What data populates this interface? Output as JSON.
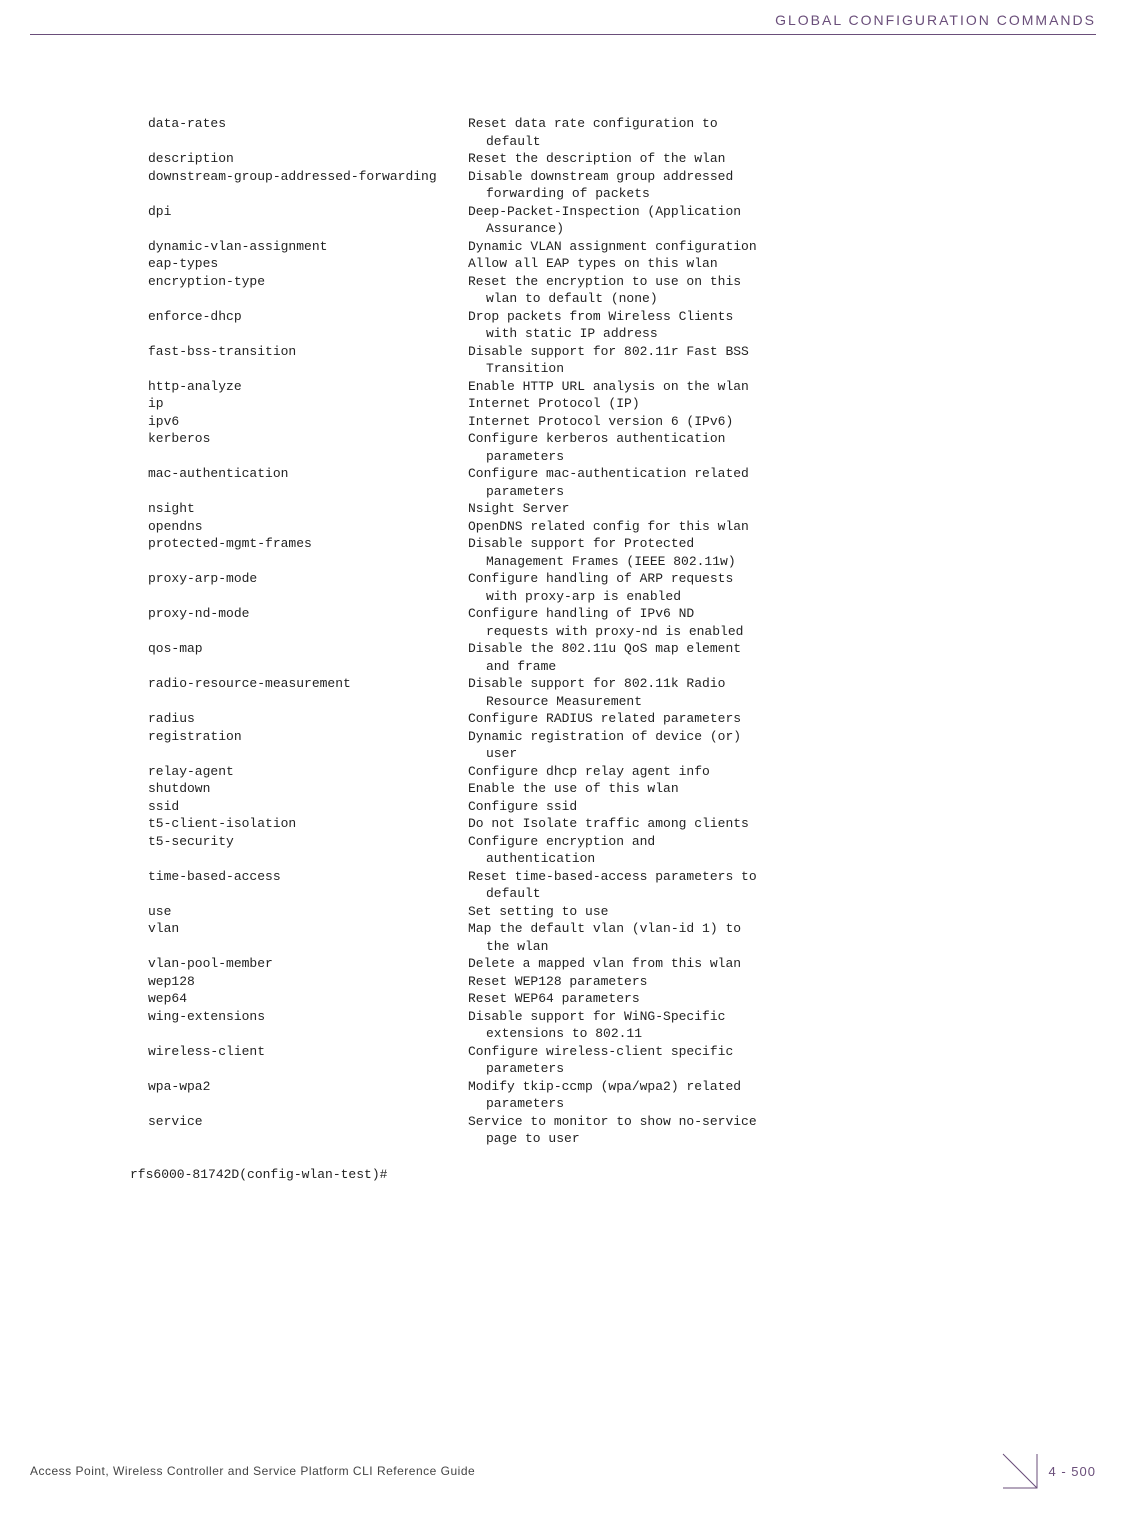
{
  "header": {
    "title": "GLOBAL CONFIGURATION COMMANDS"
  },
  "entries": [
    {
      "key": "data-rates",
      "lines": [
        "Reset data rate configuration to",
        "default"
      ]
    },
    {
      "key": "description",
      "lines": [
        "Reset the description of the wlan"
      ]
    },
    {
      "key": "downstream-group-addressed-forwarding",
      "lines": [
        "Disable downstream group addressed",
        "forwarding of packets"
      ]
    },
    {
      "key": "dpi",
      "lines": [
        "Deep-Packet-Inspection (Application",
        "Assurance)"
      ]
    },
    {
      "key": "dynamic-vlan-assignment",
      "lines": [
        "Dynamic VLAN assignment configuration"
      ]
    },
    {
      "key": "eap-types",
      "lines": [
        "Allow all EAP types on this wlan"
      ]
    },
    {
      "key": "encryption-type",
      "lines": [
        "Reset the encryption to use on this",
        "wlan to default (none)"
      ]
    },
    {
      "key": "enforce-dhcp",
      "lines": [
        "Drop packets from Wireless Clients",
        "with static IP address"
      ]
    },
    {
      "key": "fast-bss-transition",
      "lines": [
        "Disable support for 802.11r Fast BSS",
        "Transition"
      ]
    },
    {
      "key": "http-analyze",
      "lines": [
        "Enable HTTP URL analysis on the wlan"
      ]
    },
    {
      "key": "ip",
      "lines": [
        "Internet Protocol (IP)"
      ]
    },
    {
      "key": "ipv6",
      "lines": [
        "Internet Protocol version 6 (IPv6)"
      ]
    },
    {
      "key": "kerberos",
      "lines": [
        "Configure kerberos authentication",
        "parameters"
      ]
    },
    {
      "key": "mac-authentication",
      "lines": [
        "Configure mac-authentication related",
        "parameters"
      ]
    },
    {
      "key": "nsight",
      "lines": [
        "Nsight Server"
      ]
    },
    {
      "key": "opendns",
      "lines": [
        "OpenDNS related config for this wlan"
      ]
    },
    {
      "key": "protected-mgmt-frames",
      "lines": [
        "Disable support for Protected",
        "Management Frames (IEEE 802.11w)"
      ]
    },
    {
      "key": "proxy-arp-mode",
      "lines": [
        "Configure handling of ARP requests",
        "with proxy-arp is enabled"
      ]
    },
    {
      "key": "proxy-nd-mode",
      "lines": [
        "Configure handling of IPv6 ND",
        "requests with proxy-nd is enabled"
      ]
    },
    {
      "key": "qos-map",
      "lines": [
        "Disable the 802.11u QoS map element",
        "and frame"
      ]
    },
    {
      "key": "radio-resource-measurement",
      "lines": [
        "Disable support for 802.11k Radio",
        "Resource Measurement"
      ]
    },
    {
      "key": "radius",
      "lines": [
        "Configure RADIUS related parameters"
      ]
    },
    {
      "key": "registration",
      "lines": [
        "Dynamic registration of device (or)",
        "user"
      ]
    },
    {
      "key": "relay-agent",
      "lines": [
        "Configure dhcp relay agent info"
      ]
    },
    {
      "key": "shutdown",
      "lines": [
        "Enable the use of this wlan"
      ]
    },
    {
      "key": "ssid",
      "lines": [
        "Configure ssid"
      ]
    },
    {
      "key": "t5-client-isolation",
      "lines": [
        "Do not Isolate traffic among clients"
      ]
    },
    {
      "key": "t5-security",
      "lines": [
        "Configure encryption and",
        "authentication"
      ]
    },
    {
      "key": "time-based-access",
      "lines": [
        "Reset time-based-access parameters to",
        "default"
      ]
    },
    {
      "key": "use",
      "lines": [
        "Set setting to use"
      ]
    },
    {
      "key": "vlan",
      "lines": [
        "Map the default vlan (vlan-id 1) to",
        "the wlan"
      ]
    },
    {
      "key": "vlan-pool-member",
      "lines": [
        "Delete a mapped vlan from this wlan"
      ]
    },
    {
      "key": "wep128",
      "lines": [
        "Reset WEP128 parameters"
      ]
    },
    {
      "key": "wep64",
      "lines": [
        "Reset WEP64 parameters"
      ]
    },
    {
      "key": "wing-extensions",
      "lines": [
        "Disable support for WiNG-Specific",
        "extensions to 802.11"
      ]
    },
    {
      "key": "wireless-client",
      "lines": [
        "Configure wireless-client specific",
        "parameters"
      ]
    },
    {
      "key": "wpa-wpa2",
      "lines": [
        "Modify tkip-ccmp (wpa/wpa2) related",
        "parameters"
      ]
    },
    {
      "key": "",
      "lines": [
        ""
      ]
    },
    {
      "key": "service",
      "lines": [
        "Service to monitor to show no-service",
        "page to user"
      ]
    }
  ],
  "prompt": "rfs6000-81742D(config-wlan-test)#",
  "footer": {
    "left": "Access Point, Wireless Controller and Service Platform CLI Reference Guide",
    "page": "4 - 500"
  }
}
